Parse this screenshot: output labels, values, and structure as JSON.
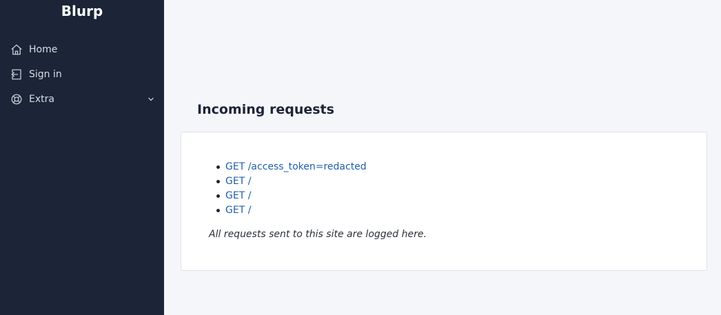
{
  "sidebar": {
    "brand": "Blurp",
    "items": [
      {
        "label": "Home",
        "icon": "home-icon"
      },
      {
        "label": "Sign in",
        "icon": "sign-in-icon"
      },
      {
        "label": "Extra",
        "icon": "lifebuoy-icon"
      }
    ]
  },
  "main": {
    "title": "Incoming requests",
    "requests": [
      "GET /access_token=redacted",
      "GET /",
      "GET /",
      "GET /"
    ],
    "note": "All requests sent to this site are logged here."
  },
  "colors": {
    "sidebar_bg": "#1b2537",
    "page_bg": "#f5f6fa",
    "link": "#1f5fa8"
  }
}
